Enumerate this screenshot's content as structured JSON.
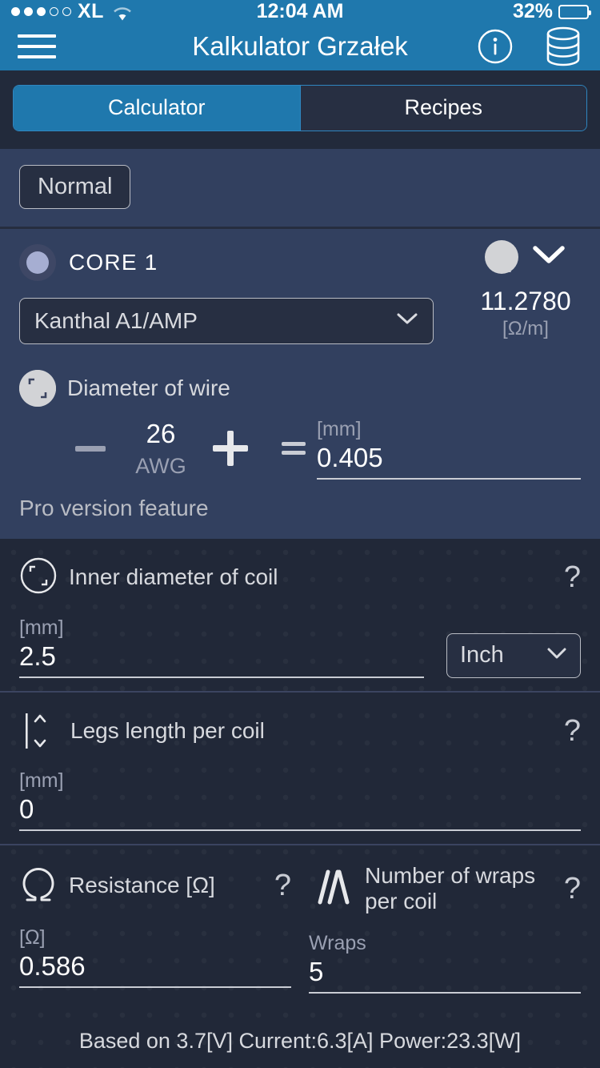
{
  "status_bar": {
    "signal_dots": [
      "on",
      "on",
      "on",
      "off",
      "off"
    ],
    "carrier": "XL",
    "wifi_icon": "wifi-icon",
    "time": "12:04 AM",
    "battery_percent": "32%",
    "battery_level": 32
  },
  "nav": {
    "menu_icon": "hamburger-menu-icon",
    "title": "Kalkulator Grzałek",
    "info_icon": "info-icon",
    "database_icon": "database-icon"
  },
  "tabs": [
    {
      "label": "Calculator",
      "active": true
    },
    {
      "label": "Recipes",
      "active": false
    }
  ],
  "mode": {
    "label": "Normal"
  },
  "core": {
    "icon": "core-circle-icon",
    "label": "CORE 1",
    "help": "?",
    "toggle_icon": "gray-circle-icon",
    "expand_icon": "chevron-down-icon",
    "resistivity_value": "11.2780",
    "resistivity_unit": "[Ω/m]",
    "material": "Kanthal A1/AMP",
    "material_chevron": "chevron-down-icon"
  },
  "wire": {
    "icon": "diameter-filled-icon",
    "label": "Diameter of wire",
    "minus": "−",
    "awg_value": "26",
    "awg_unit": "AWG",
    "plus": "+",
    "equals": "=",
    "mm_unit": "[mm]",
    "mm_value": "0.405",
    "pro_note": "Pro version feature"
  },
  "inner_diameter": {
    "icon": "diameter-outline-icon",
    "label": "Inner diameter of coil",
    "help": "?",
    "unit": "[mm]",
    "value": "2.5",
    "unit_select": "Inch",
    "unit_select_chevron": "chevron-down-icon"
  },
  "legs": {
    "icon": "legs-length-icon",
    "label": "Legs length per coil",
    "help": "?",
    "unit": "[mm]",
    "value": "0"
  },
  "resistance": {
    "icon": "omega-icon",
    "label": "Resistance [Ω]",
    "help": "?",
    "unit": "[Ω]",
    "value": "0.586"
  },
  "wraps": {
    "icon": "coil-wraps-icon",
    "label": "Number of wraps per coil",
    "help": "?",
    "unit": "Wraps",
    "value": "5"
  },
  "footer": {
    "note": "Based on 3.7[V] Current:6.3[A] Power:23.3[W]"
  },
  "colors": {
    "brand_blue": "#1f78ad",
    "panel_navy": "#32405f",
    "panel_dark": "#212838",
    "tab_bg": "#222a3b",
    "text_light": "#d7d9de",
    "text_muted": "#9aa0b2"
  }
}
